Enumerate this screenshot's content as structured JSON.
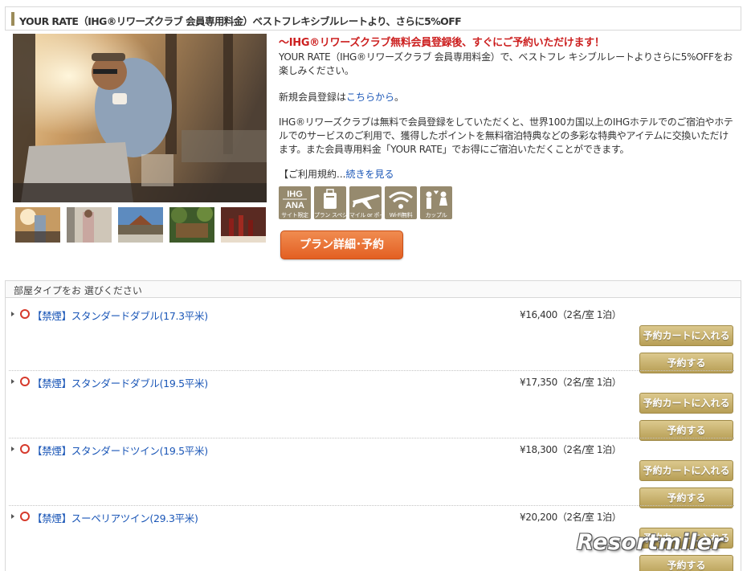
{
  "plan": {
    "title": "YOUR RATE（IHG®リワーズクラブ 会員専用料金）ベストフレキシブルレートより、さらに5%OFF",
    "catch": "〜IHG®リワーズクラブ無料会員登録後、すぐにご予約いただけます！",
    "description": "YOUR RATE（IHG®リワーズクラブ 会員専用料金）で、ベストフレ キシブルレートよりさらに5%OFFをお楽しみください。",
    "register_prefix": "新規会員登録は",
    "register_link": "こちらから",
    "register_suffix": "。",
    "club_text": "IHG®リワーズクラブは無料で会員登録をしていただくと、世界100カ国以上のIHGホテルでのご宿泊やホテルでのサービスのご利用で、獲得したポイントを無料宿泊特典などの多彩な特典やアイテムに交換いただけます。また会員専用料金「YOUR RATE」でお得にご宿泊いただくことができます。",
    "terms_prefix": "【ご利用規約...",
    "terms_link": "続きを見る",
    "badges": [
      {
        "icon": "ihg-ana-icon",
        "top": "IHG",
        "mid": "ANA",
        "label": "サイト限定"
      },
      {
        "icon": "suitcase-icon",
        "label": "プラン スペシャル"
      },
      {
        "icon": "airplane-icon",
        "label": "マイル or ポイントOK"
      },
      {
        "icon": "wifi-icon",
        "label": "Wi-Fi無料"
      },
      {
        "icon": "couple-icon",
        "label": "カップル"
      }
    ],
    "detail_button": "プラン詳細･予約"
  },
  "rooms": {
    "header": "部屋タイプをお 選びください",
    "cart_label": "予約カートに入れる",
    "book_label": "予約する",
    "items": [
      {
        "name": "【禁煙】スタンダードダブル(17.3平米)",
        "price": "¥16,400（2名/室 1泊）"
      },
      {
        "name": "【禁煙】スタンダードダブル(19.5平米)",
        "price": "¥17,350（2名/室 1泊）"
      },
      {
        "name": "【禁煙】スタンダードツイン(19.5平米)",
        "price": "¥18,300（2名/室 1泊）"
      },
      {
        "name": "【禁煙】スーペリアツイン(29.3平米)",
        "price": "¥20,200（2名/室 1泊）"
      }
    ]
  },
  "watermark": "Resortmiler"
}
